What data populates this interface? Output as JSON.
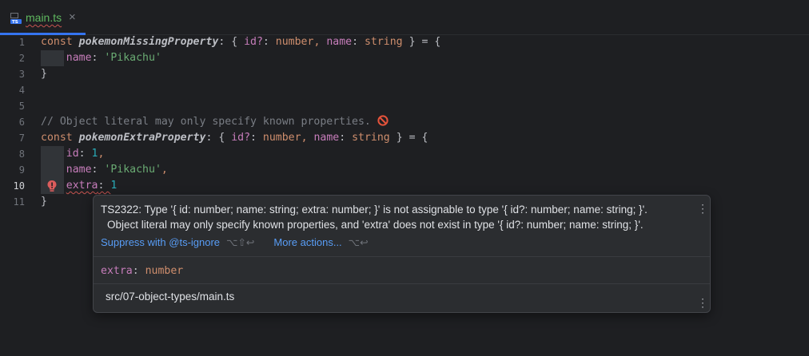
{
  "tab": {
    "file_name": "main.ts",
    "close_glyph": "×",
    "icon": "typescript-file-icon"
  },
  "lines": [
    {
      "n": "1",
      "tokens": [
        {
          "t": "const ",
          "c": "kw"
        },
        {
          "t": "pokemonMissingProperty",
          "c": "var"
        },
        {
          "t": ": { ",
          "c": "plain"
        },
        {
          "t": "id?",
          "c": "prop"
        },
        {
          "t": ": ",
          "c": "plain"
        },
        {
          "t": "number",
          "c": "kw"
        },
        {
          "t": ", ",
          "c": "kw"
        },
        {
          "t": "name",
          "c": "prop"
        },
        {
          "t": ": ",
          "c": "plain"
        },
        {
          "t": "string",
          "c": "kw"
        },
        {
          "t": " } = {",
          "c": "plain"
        }
      ]
    },
    {
      "n": "2",
      "tokens": [
        {
          "t": "    ",
          "c": "plain"
        },
        {
          "t": "name",
          "c": "prop"
        },
        {
          "t": ": ",
          "c": "plain"
        },
        {
          "t": "'Pikachu'",
          "c": "str"
        }
      ]
    },
    {
      "n": "3",
      "tokens": [
        {
          "t": "}",
          "c": "plain"
        }
      ]
    },
    {
      "n": "4",
      "tokens": []
    },
    {
      "n": "5",
      "tokens": []
    },
    {
      "n": "6",
      "tokens": [
        {
          "t": "// Object literal may only specify known properties.",
          "c": "cmt"
        }
      ]
    },
    {
      "n": "7",
      "tokens": [
        {
          "t": "const ",
          "c": "kw"
        },
        {
          "t": "pokemonExtraProperty",
          "c": "var"
        },
        {
          "t": ": { ",
          "c": "plain"
        },
        {
          "t": "id?",
          "c": "prop"
        },
        {
          "t": ": ",
          "c": "plain"
        },
        {
          "t": "number",
          "c": "kw"
        },
        {
          "t": ", ",
          "c": "kw"
        },
        {
          "t": "name",
          "c": "prop"
        },
        {
          "t": ": ",
          "c": "plain"
        },
        {
          "t": "string",
          "c": "kw"
        },
        {
          "t": " } = {",
          "c": "plain"
        }
      ]
    },
    {
      "n": "8",
      "tokens": [
        {
          "t": "    ",
          "c": "plain"
        },
        {
          "t": "id",
          "c": "prop"
        },
        {
          "t": ": ",
          "c": "plain"
        },
        {
          "t": "1",
          "c": "num"
        },
        {
          "t": ",",
          "c": "kw"
        }
      ]
    },
    {
      "n": "9",
      "tokens": [
        {
          "t": "    ",
          "c": "plain"
        },
        {
          "t": "name",
          "c": "prop"
        },
        {
          "t": ": ",
          "c": "plain"
        },
        {
          "t": "'Pikachu'",
          "c": "str"
        },
        {
          "t": ",",
          "c": "kw"
        }
      ]
    },
    {
      "n": "10",
      "tokens": [
        {
          "t": "    ",
          "c": "plain"
        },
        {
          "t": "extra",
          "c": "prop err-underline"
        },
        {
          "t": ": ",
          "c": "plain err-underline"
        },
        {
          "t": "1",
          "c": "num"
        }
      ]
    },
    {
      "n": "11",
      "tokens": [
        {
          "t": "}",
          "c": "plain"
        }
      ]
    }
  ],
  "current_line": "10",
  "popup": {
    "message_line1": "TS2322: Type '{ id: number; name: string; extra: number; }' is not assignable to type '{ id?: number; name: string; }'.",
    "message_line2": "Object literal may only specify known properties, and 'extra' does not exist in type '{ id?: number; name: string; }'.",
    "suppress_label": "Suppress with @ts-ignore",
    "suppress_shortcut": "⌥⇧↩",
    "more_actions_label": "More actions...",
    "more_actions_shortcut": "⌥↩",
    "type_prop": "extra",
    "type_colon": ": ",
    "type_value": "number",
    "file_path": "src/07-object-types/main.ts",
    "kebab_glyph": "⋮"
  },
  "colors": {
    "background": "#1e1f22",
    "keyword": "#cf8e6d",
    "property": "#c77dbb",
    "string": "#6aab73",
    "number": "#2aacb8",
    "comment": "#7a7e85",
    "error": "#c75450",
    "link": "#589df6",
    "accent": "#3574f0"
  }
}
